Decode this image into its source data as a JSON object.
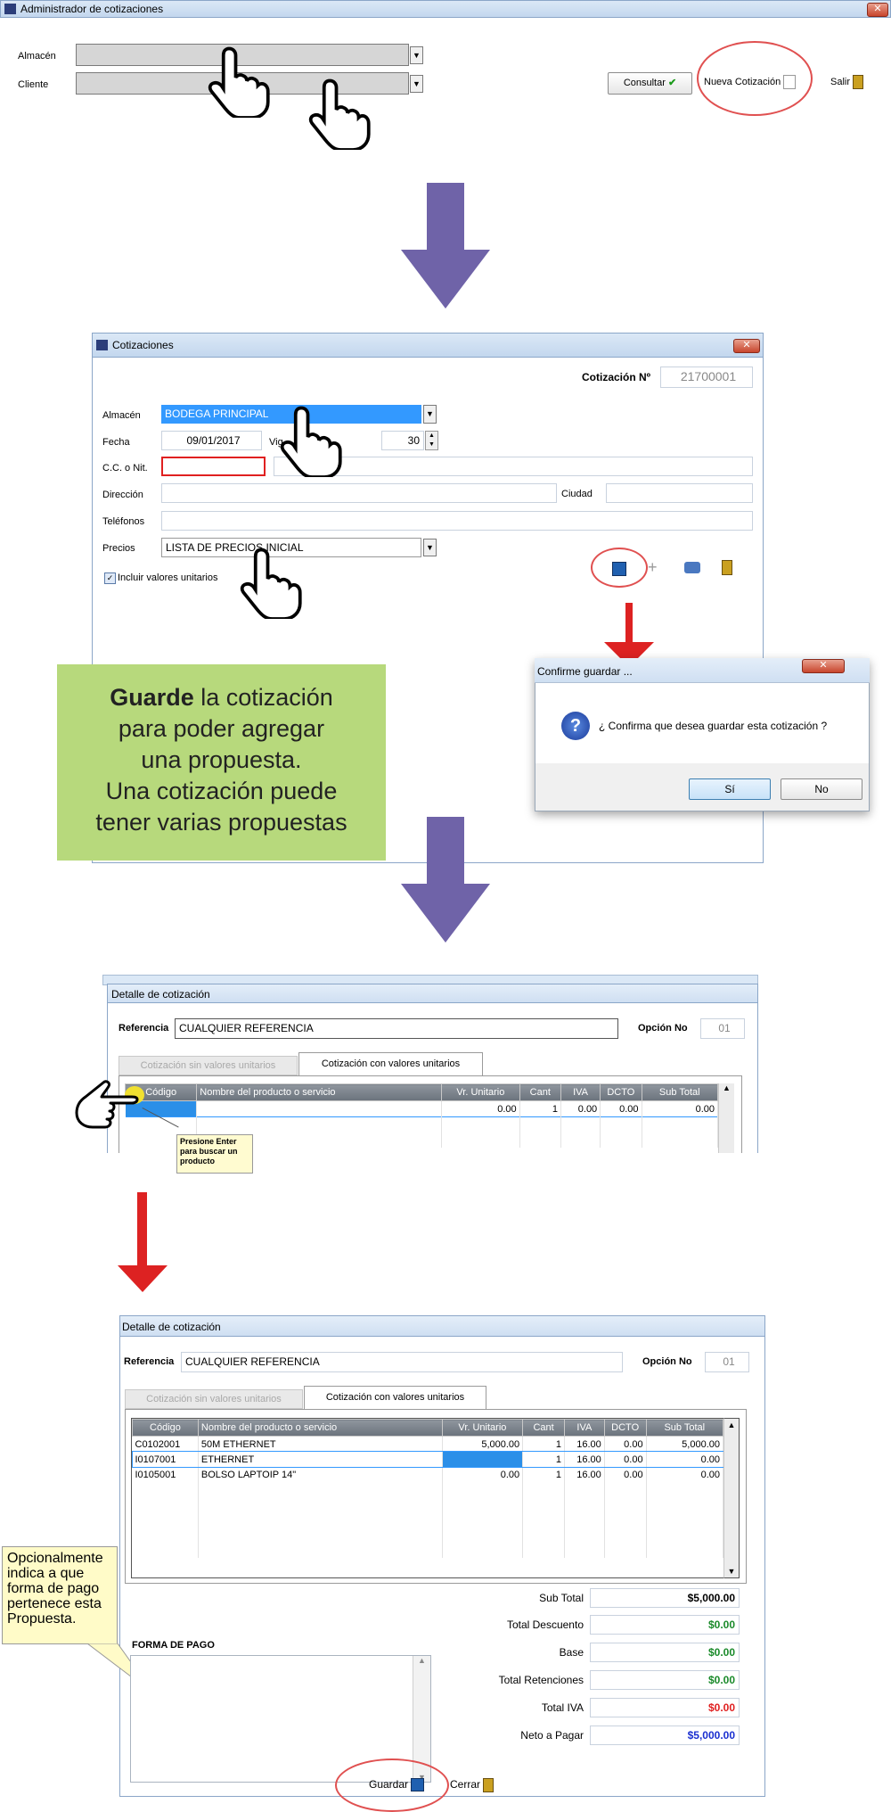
{
  "admin": {
    "title": "Administrador de cotizaciones",
    "close": "✕",
    "almacen_label": "Almacén",
    "cliente_label": "Cliente",
    "consultar": "Consultar",
    "nueva": "Nueva Cotización",
    "salir": "Salir"
  },
  "cotizaciones": {
    "title": "Cotizaciones",
    "cotizacion_label": "Cotización Nº",
    "cotizacion_no": "21700001",
    "almacen_label": "Almacén",
    "almacen_value": "BODEGA PRINCIPAL",
    "fecha_label": "Fecha",
    "fecha_value": "09/01/2017",
    "vigencia_label": "Vig",
    "vigencia_value": "30",
    "nit_label": "C.C. o Nit.",
    "direccion_label": "Dirección",
    "ciudad_label": "Ciudad",
    "telefonos_label": "Teléfonos",
    "precios_label": "Precios",
    "precios_value": "LISTA DE PRECIOS INICIAL",
    "incluir_label": "Incluir valores unitarios"
  },
  "callout_green": {
    "bold": "Guarde",
    "line1_rest": " la cotización",
    "line2": "para poder agregar",
    "line3": "una propuesta.",
    "line4": "Una cotización puede",
    "line5": "tener varias propuestas"
  },
  "confirm": {
    "title": "Confirme guardar ...",
    "message": "¿ Confirma que desea guardar esta cotización ?",
    "yes": "Sí",
    "no": "No"
  },
  "detalle1": {
    "title": "Detalle de cotización",
    "referencia_label": "Referencia",
    "referencia_value": "CUALQUIER REFERENCIA",
    "opcion_label": "Opción No",
    "opcion_value": "01",
    "tab_sin": "Cotización sin valores unitarios",
    "tab_con": "Cotización con valores unitarios",
    "tooltip": "Presione Enter para buscar un producto",
    "row": {
      "codigo": "",
      "nombre": "",
      "vr": "0.00",
      "cant": "1",
      "iva": "0.00",
      "dcto": "0.00",
      "sub": "0.00"
    }
  },
  "columns": [
    "Código",
    "Nombre del producto o servicio",
    "Vr. Unitario",
    "Cant",
    "IVA",
    "DCTO",
    "Sub Total"
  ],
  "detalle2": {
    "title": "Detalle de cotización",
    "referencia_label": "Referencia",
    "referencia_value": "CUALQUIER REFERENCIA",
    "opcion_label": "Opción No",
    "opcion_value": "01",
    "tab_sin": "Cotización sin valores unitarios",
    "tab_con": "Cotización con valores unitarios",
    "rows": [
      {
        "codigo": "C0102001",
        "nombre": "50M ETHERNET",
        "vr": "5,000.00",
        "cant": "1",
        "iva": "16.00",
        "dcto": "0.00",
        "sub": "5,000.00"
      },
      {
        "codigo": "I0107001",
        "nombre": "ETHERNET",
        "vr": "",
        "cant": "1",
        "iva": "16.00",
        "dcto": "0.00",
        "sub": "0.00"
      },
      {
        "codigo": "I0105001",
        "nombre": "BOLSO LAPTOIP 14\"",
        "vr": "0.00",
        "cant": "1",
        "iva": "16.00",
        "dcto": "0.00",
        "sub": "0.00"
      }
    ],
    "forma_pago_label": "FORMA DE PAGO",
    "callout": "Opcionalmente indica a que forma de pago pertenece esta Propuesta.",
    "totals": [
      {
        "label": "Sub Total",
        "value": "$5,000.00",
        "color": "#000000"
      },
      {
        "label": "Total Descuento",
        "value": "$0.00",
        "color": "#1a8a2a"
      },
      {
        "label": "Base",
        "value": "$0.00",
        "color": "#1a8a2a"
      },
      {
        "label": "Total Retenciones",
        "value": "$0.00",
        "color": "#1a8a2a"
      },
      {
        "label": "Total IVA",
        "value": "$0.00",
        "color": "#e02020"
      },
      {
        "label": "Neto a Pagar",
        "value": "$5,000.00",
        "color": "#1a2fd0"
      }
    ],
    "guardar": "Guardar",
    "cerrar": "Cerrar"
  },
  "colors": {
    "arrow_purple": "#6f63a8",
    "arrow_red": "#dd2222",
    "callout_green": "#b7d97c",
    "selection_blue": "#1e90ff"
  }
}
